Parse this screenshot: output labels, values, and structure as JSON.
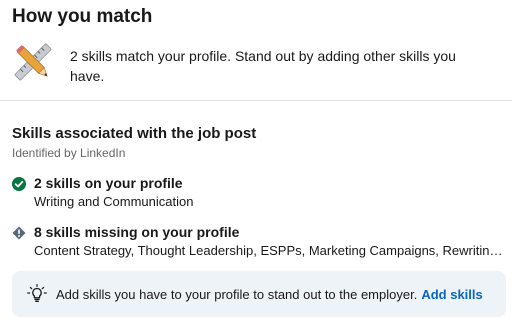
{
  "header": {
    "title": "How you match"
  },
  "match": {
    "icon": "pencil-ruler-icon",
    "summary": "2 skills match your profile. Stand out by adding other skills you have."
  },
  "skills": {
    "title": "Skills associated with the job post",
    "subtitle": "Identified by LinkedIn",
    "on_profile": {
      "icon": "check-circle-icon",
      "heading": "2 skills on your profile",
      "list": "Writing and Communication"
    },
    "missing": {
      "icon": "warning-diamond-icon",
      "heading": "8 skills missing on your profile",
      "list": "Content Strategy, Thought Leadership, ESPPs, Marketing Campaigns, Rewriting,..."
    }
  },
  "notice": {
    "icon": "lightbulb-icon",
    "text": "Add skills you have to your profile to stand out to the employer.",
    "link": "Add skills"
  },
  "colors": {
    "link": "#0a66c2",
    "success": "#057642",
    "warning": "#56687a",
    "notice_bg": "#eef3f8"
  }
}
